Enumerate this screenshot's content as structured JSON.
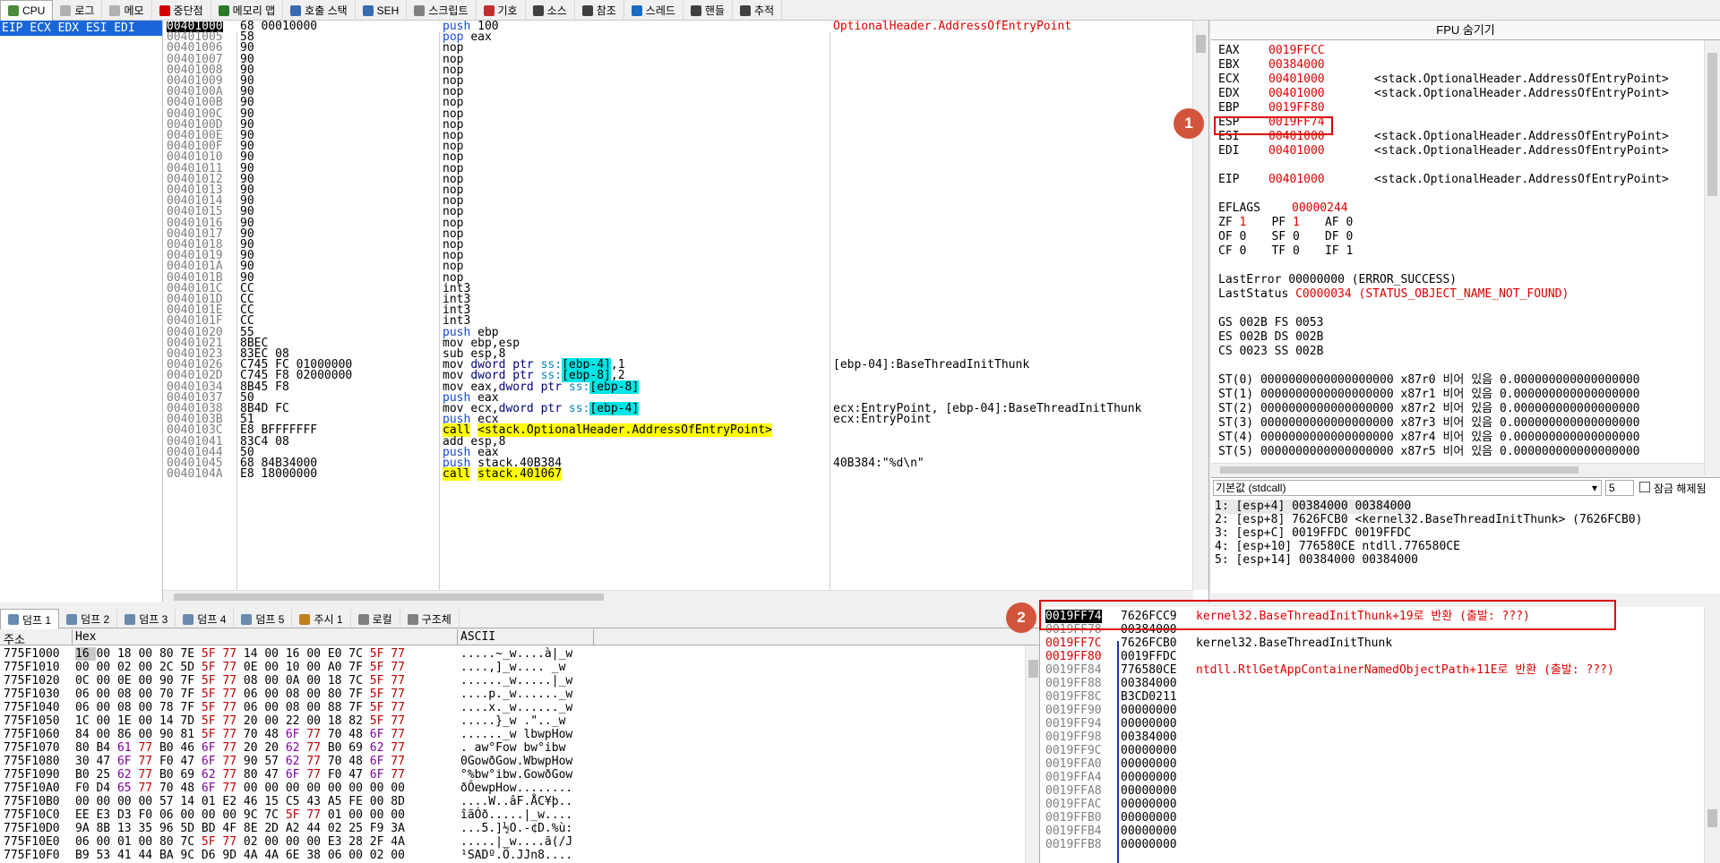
{
  "tabs": [
    {
      "label": "CPU",
      "icon": "cpu-icon",
      "color": "#4a8a3a"
    },
    {
      "label": "로그",
      "icon": "log-icon",
      "color": "#b0b0b0"
    },
    {
      "label": "메모",
      "icon": "note-icon",
      "color": "#b0b0b0"
    },
    {
      "label": "중단점",
      "icon": "breakpoint-icon",
      "color": "#d00000"
    },
    {
      "label": "메모리 맵",
      "icon": "memory-map-icon",
      "color": "#2a7a2a"
    },
    {
      "label": "호출 스택",
      "icon": "call-stack-icon",
      "color": "#3a6ab0"
    },
    {
      "label": "SEH",
      "icon": "seh-icon",
      "color": "#3a6ab0"
    },
    {
      "label": "스크립트",
      "icon": "script-icon",
      "color": "#808080"
    },
    {
      "label": "기호",
      "icon": "symbol-icon",
      "color": "#c03030"
    },
    {
      "label": "소스",
      "icon": "source-icon",
      "color": "#404040"
    },
    {
      "label": "참조",
      "icon": "search-icon",
      "color": "#404040"
    },
    {
      "label": "스레드",
      "icon": "thread-icon",
      "color": "#1a6ac0"
    },
    {
      "label": "핸들",
      "icon": "handle-icon",
      "color": "#404040"
    },
    {
      "label": "추적",
      "icon": "trace-icon",
      "color": "#404040"
    }
  ],
  "register_strip": "EIP ECX EDX ESI EDI",
  "disasm": [
    {
      "addr": "00401000",
      "bytes": "68 00010000",
      "ins": "push 100",
      "cmt": "OptionalHeader.AddressOfEntryPoint"
    },
    {
      "addr": "00401005",
      "bytes": "58",
      "ins": "pop eax",
      "cmt": ""
    },
    {
      "addr": "00401006",
      "bytes": "90",
      "ins": "nop",
      "cmt": ""
    },
    {
      "addr": "00401007",
      "bytes": "90",
      "ins": "nop",
      "cmt": ""
    },
    {
      "addr": "00401008",
      "bytes": "90",
      "ins": "nop",
      "cmt": ""
    },
    {
      "addr": "00401009",
      "bytes": "90",
      "ins": "nop",
      "cmt": ""
    },
    {
      "addr": "0040100A",
      "bytes": "90",
      "ins": "nop",
      "cmt": ""
    },
    {
      "addr": "0040100B",
      "bytes": "90",
      "ins": "nop",
      "cmt": ""
    },
    {
      "addr": "0040100C",
      "bytes": "90",
      "ins": "nop",
      "cmt": ""
    },
    {
      "addr": "0040100D",
      "bytes": "90",
      "ins": "nop",
      "cmt": ""
    },
    {
      "addr": "0040100E",
      "bytes": "90",
      "ins": "nop",
      "cmt": ""
    },
    {
      "addr": "0040100F",
      "bytes": "90",
      "ins": "nop",
      "cmt": ""
    },
    {
      "addr": "00401010",
      "bytes": "90",
      "ins": "nop",
      "cmt": ""
    },
    {
      "addr": "00401011",
      "bytes": "90",
      "ins": "nop",
      "cmt": ""
    },
    {
      "addr": "00401012",
      "bytes": "90",
      "ins": "nop",
      "cmt": ""
    },
    {
      "addr": "00401013",
      "bytes": "90",
      "ins": "nop",
      "cmt": ""
    },
    {
      "addr": "00401014",
      "bytes": "90",
      "ins": "nop",
      "cmt": ""
    },
    {
      "addr": "00401015",
      "bytes": "90",
      "ins": "nop",
      "cmt": ""
    },
    {
      "addr": "00401016",
      "bytes": "90",
      "ins": "nop",
      "cmt": ""
    },
    {
      "addr": "00401017",
      "bytes": "90",
      "ins": "nop",
      "cmt": ""
    },
    {
      "addr": "00401018",
      "bytes": "90",
      "ins": "nop",
      "cmt": ""
    },
    {
      "addr": "00401019",
      "bytes": "90",
      "ins": "nop",
      "cmt": ""
    },
    {
      "addr": "0040101A",
      "bytes": "90",
      "ins": "nop",
      "cmt": ""
    },
    {
      "addr": "0040101B",
      "bytes": "90",
      "ins": "nop",
      "cmt": ""
    },
    {
      "addr": "0040101C",
      "bytes": "CC",
      "ins": "int3",
      "cmt": ""
    },
    {
      "addr": "0040101D",
      "bytes": "CC",
      "ins": "int3",
      "cmt": ""
    },
    {
      "addr": "0040101E",
      "bytes": "CC",
      "ins": "int3",
      "cmt": ""
    },
    {
      "addr": "0040101F",
      "bytes": "CC",
      "ins": "int3",
      "cmt": ""
    },
    {
      "addr": "00401020",
      "bytes": "55",
      "ins": "push ebp",
      "cmt": ""
    },
    {
      "addr": "00401021",
      "bytes": "8BEC",
      "ins": "mov ebp,esp",
      "cmt": ""
    },
    {
      "addr": "00401023",
      "bytes": "83EC 08",
      "ins": "sub esp,8",
      "cmt": ""
    },
    {
      "addr": "00401026",
      "bytes": "C745 FC 01000000",
      "ins": "mov dword ptr ss:[ebp-4],1",
      "cmt": "[ebp-04]:BaseThreadInitThunk"
    },
    {
      "addr": "0040102D",
      "bytes": "C745 F8 02000000",
      "ins": "mov dword ptr ss:[ebp-8],2",
      "cmt": ""
    },
    {
      "addr": "00401034",
      "bytes": "8B45 F8",
      "ins": "mov eax,dword ptr ss:[ebp-8]",
      "cmt": ""
    },
    {
      "addr": "00401037",
      "bytes": "50",
      "ins": "push eax",
      "cmt": ""
    },
    {
      "addr": "00401038",
      "bytes": "8B4D FC",
      "ins": "mov ecx,dword ptr ss:[ebp-4]",
      "cmt": "ecx:EntryPoint, [ebp-04]:BaseThreadInitThunk"
    },
    {
      "addr": "0040103B",
      "bytes": "51",
      "ins": "push ecx",
      "cmt": "ecx:EntryPoint"
    },
    {
      "addr": "0040103C",
      "bytes": "E8 BFFFFFFF",
      "ins": "call <stack.OptionalHeader.AddressOfEntryPoint>",
      "cmt": ""
    },
    {
      "addr": "00401041",
      "bytes": "83C4 08",
      "ins": "add esp,8",
      "cmt": ""
    },
    {
      "addr": "00401044",
      "bytes": "50",
      "ins": "push eax",
      "cmt": ""
    },
    {
      "addr": "00401045",
      "bytes": "68 84B34000",
      "ins": "push stack.40B384",
      "cmt": "40B384:\"%d\\n\""
    },
    {
      "addr": "0040104A",
      "bytes": "E8 18000000",
      "ins": "call stack.401067",
      "cmt": ""
    }
  ],
  "fpu": {
    "title": "FPU 숨기기",
    "regs": [
      {
        "name": "EAX",
        "val": "0019FFCC",
        "cmt": ""
      },
      {
        "name": "EBX",
        "val": "00384000",
        "cmt": ""
      },
      {
        "name": "ECX",
        "val": "00401000",
        "cmt": "<stack.OptionalHeader.AddressOfEntryPoint>"
      },
      {
        "name": "EDX",
        "val": "00401000",
        "cmt": "<stack.OptionalHeader.AddressOfEntryPoint>"
      },
      {
        "name": "EBP",
        "val": "0019FF80",
        "cmt": ""
      },
      {
        "name": "ESP",
        "val": "0019FF74",
        "cmt": ""
      },
      {
        "name": "ESI",
        "val": "00401000",
        "cmt": "<stack.OptionalHeader.AddressOfEntryPoint>"
      },
      {
        "name": "EDI",
        "val": "00401000",
        "cmt": "<stack.OptionalHeader.AddressOfEntryPoint>"
      }
    ],
    "eip": {
      "name": "EIP",
      "val": "00401000",
      "cmt": "<stack.OptionalHeader.AddressOfEntryPoint>"
    },
    "eflags": {
      "name": "EFLAGS",
      "val": "00000244"
    },
    "flags": [
      [
        {
          "n": "ZF",
          "v": "1",
          "hot": true
        },
        {
          "n": "PF",
          "v": "1",
          "hot": true
        },
        {
          "n": "AF",
          "v": "0",
          "hot": false
        }
      ],
      [
        {
          "n": "OF",
          "v": "0",
          "hot": false
        },
        {
          "n": "SF",
          "v": "0",
          "hot": false
        },
        {
          "n": "DF",
          "v": "0",
          "hot": false
        }
      ],
      [
        {
          "n": "CF",
          "v": "0",
          "hot": false
        },
        {
          "n": "TF",
          "v": "0",
          "hot": false
        },
        {
          "n": "IF",
          "v": "1",
          "hot": false
        }
      ]
    ],
    "last_error": {
      "label": "LastError",
      "val": "00000000 (ERROR_SUCCESS)"
    },
    "last_status": {
      "label": "LastStatus",
      "val": "C0000034 (STATUS_OBJECT_NAME_NOT_FOUND)"
    },
    "segs": [
      "GS 002B  FS 0053",
      "ES 002B  DS 002B",
      "CS 0023  SS 002B"
    ],
    "st": [
      "ST(0) 0000000000000000000 x87r0 비어 있음 0.000000000000000000",
      "ST(1) 0000000000000000000 x87r1 비어 있음 0.000000000000000000",
      "ST(2) 0000000000000000000 x87r2 비어 있음 0.000000000000000000",
      "ST(3) 0000000000000000000 x87r3 비어 있음 0.000000000000000000",
      "ST(4) 0000000000000000000 x87r4 비어 있음 0.000000000000000000",
      "ST(5) 0000000000000000000 x87r5 비어 있음 0.000000000000000000"
    ]
  },
  "callconv": {
    "select": "기본값 (stdcall)",
    "count": "5",
    "lock_label": "잠금 해제됨",
    "args": [
      "1: [esp+4] 00384000 00384000",
      "2: [esp+8] 7626FCB0 <kernel32.BaseThreadInitThunk> (7626FCB0)",
      "3: [esp+C] 0019FFDC 0019FFDC",
      "4: [esp+10] 776580CE ntdll.776580CE",
      "5: [esp+14] 00384000 00384000"
    ]
  },
  "dump_tabs": [
    {
      "label": "덤프 1",
      "icon": "dump-icon"
    },
    {
      "label": "덤프 2",
      "icon": "dump-icon"
    },
    {
      "label": "덤프 3",
      "icon": "dump-icon"
    },
    {
      "label": "덤프 4",
      "icon": "dump-icon"
    },
    {
      "label": "덤프 5",
      "icon": "dump-icon"
    },
    {
      "label": "주시 1",
      "icon": "watch-icon"
    },
    {
      "label": "로컬",
      "icon": "locals-icon"
    },
    {
      "label": "구조체",
      "icon": "struct-icon"
    }
  ],
  "dump_headers": {
    "addr": "주소",
    "hex": "Hex",
    "ascii": "ASCII"
  },
  "dump_rows": [
    {
      "addr": "775F1000",
      "hex": "16 00 18 00 80 7E 5F 77 14 00 16 00 E0 7C 5F 77",
      "ascii": ".....~_w....à|_w"
    },
    {
      "addr": "775F1010",
      "hex": "00 00 02 00 2C 5D 5F 77 0E 00 10 00 A0 7F 5F 77",
      "ascii": "....,]_w.... _w"
    },
    {
      "addr": "775F1020",
      "hex": "0C 00 0E 00 90 7F 5F 77 08 00 0A 00 18 7C 5F 77",
      "ascii": "......_w.....|_w"
    },
    {
      "addr": "775F1030",
      "hex": "06 00 08 00 70 7F 5F 77 06 00 08 00 80 7F 5F 77",
      "ascii": "....p._w......_w"
    },
    {
      "addr": "775F1040",
      "hex": "06 00 08 00 78 7F 5F 77 06 00 08 00 88 7F 5F 77",
      "ascii": "....x._w......_w"
    },
    {
      "addr": "775F1050",
      "hex": "1C 00 1E 00 14 7D 5F 77 20 00 22 00 18 82 5F 77",
      "ascii": ".....}_w .\".._w"
    },
    {
      "addr": "775F1060",
      "hex": "84 00 86 00 90 81 5F 77 70 48 6F 77 70 48 6F 77",
      "ascii": "......_w lbwpHow"
    },
    {
      "addr": "775F1070",
      "hex": "80 B4 61 77 B0 46 6F 77 20 20 62 77 B0 69 62 77",
      "ascii": ". aw°Fow  bw°ibw"
    },
    {
      "addr": "775F1080",
      "hex": "30 47 6F 77 F0 47 6F 77 90 57 62 77 70 48 6F 77",
      "ascii": "0GowðGow.WbwpHow"
    },
    {
      "addr": "775F1090",
      "hex": "B0 25 62 77 B0 69 62 77 80 47 6F 77 F0 47 6F 77",
      "ascii": "°%bw°ibw.GowðGow"
    },
    {
      "addr": "775F10A0",
      "hex": "F0 D4 65 77 70 48 6F 77 00 00 00 00 00 00 00 00",
      "ascii": "ðÔewpHow........"
    },
    {
      "addr": "775F10B0",
      "hex": "00 00 00 00 57 14 01 E2 46 15 C5 43 A5 FE 00 8D",
      "ascii": "....W..âF.ÅC¥þ.."
    },
    {
      "addr": "775F10C0",
      "hex": "EE E3 D3 F0 06 00 00 00 9C 7C 5F 77 01 00 00 00",
      "ascii": "îãÓð.....|_w...."
    },
    {
      "addr": "775F10D0",
      "hex": "9A 8B 13 35 96 5D BD 4F 8E 2D A2 44 02 25 F9 3A",
      "ascii": "...5.]½O.-¢D.%ù:"
    },
    {
      "addr": "775F10E0",
      "hex": "06 00 01 00 80 7C 5F 77 02 00 00 00 E3 28 2F 4A",
      "ascii": ".....|_w....ã(/J"
    },
    {
      "addr": "775F10F0",
      "hex": "B9 53 41 44 BA 9C D6 9D 4A 4A 6E 38 06 00 02 00",
      "ascii": "¹SADº.Ö.JJn8...."
    }
  ],
  "stack_rows": [
    {
      "addr": "0019FF74",
      "val": "7626FCC9",
      "cmt": "kernel32.BaseThreadInitThunk+19로 반환 (출발: ???)",
      "cmt_red": true
    },
    {
      "addr": "0019FF78",
      "val": "00384000",
      "cmt": "",
      "cmt_red": false
    },
    {
      "addr": "0019FF7C",
      "val": "7626FCB0",
      "cmt": "kernel32.BaseThreadInitThunk",
      "cmt_red": false
    },
    {
      "addr": "0019FF80",
      "val": "0019FFDC",
      "cmt": "",
      "cmt_red": false
    },
    {
      "addr": "0019FF84",
      "val": "776580CE",
      "cmt": "ntdll.RtlGetAppContainerNamedObjectPath+11E로 반환 (출발: ???)",
      "cmt_red": true
    },
    {
      "addr": "0019FF88",
      "val": "00384000",
      "cmt": "",
      "cmt_red": false
    },
    {
      "addr": "0019FF8C",
      "val": "B3CD0211",
      "cmt": "",
      "cmt_red": false
    },
    {
      "addr": "0019FF90",
      "val": "00000000",
      "cmt": "",
      "cmt_red": false
    },
    {
      "addr": "0019FF94",
      "val": "00000000",
      "cmt": "",
      "cmt_red": false
    },
    {
      "addr": "0019FF98",
      "val": "00384000",
      "cmt": "",
      "cmt_red": false
    },
    {
      "addr": "0019FF9C",
      "val": "00000000",
      "cmt": "",
      "cmt_red": false
    },
    {
      "addr": "0019FFA0",
      "val": "00000000",
      "cmt": "",
      "cmt_red": false
    },
    {
      "addr": "0019FFA4",
      "val": "00000000",
      "cmt": "",
      "cmt_red": false
    },
    {
      "addr": "0019FFA8",
      "val": "00000000",
      "cmt": "",
      "cmt_red": false
    },
    {
      "addr": "0019FFAC",
      "val": "00000000",
      "cmt": "",
      "cmt_red": false
    },
    {
      "addr": "0019FFB0",
      "val": "00000000",
      "cmt": "",
      "cmt_red": false
    },
    {
      "addr": "0019FFB4",
      "val": "00000000",
      "cmt": "",
      "cmt_red": false
    },
    {
      "addr": "0019FFB8",
      "val": "00000000",
      "cmt": "",
      "cmt_red": false
    }
  ],
  "annotations": [
    {
      "label": "1"
    },
    {
      "label": "2"
    }
  ],
  "colors": {
    "accent": "#1a66d8",
    "highlight": "#e00000",
    "badge": "#d2553b"
  }
}
